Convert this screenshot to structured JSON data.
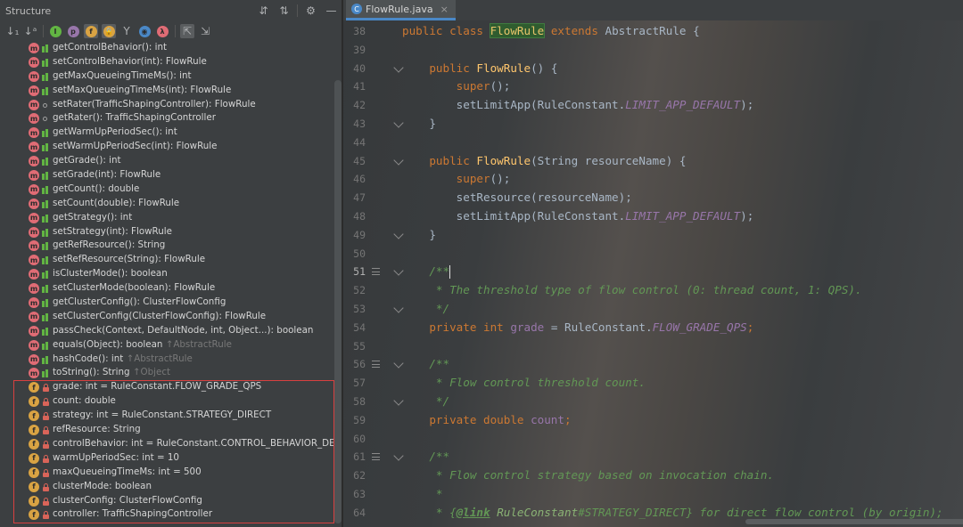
{
  "structure": {
    "title": "Structure",
    "header_icons": [
      "expand-all-icon",
      "collapse-all-icon",
      "settings-gear-icon",
      "minimize-icon"
    ],
    "toolbar_icons": [
      {
        "name": "sort-by-visibility-icon",
        "glyph": "↓₁",
        "style": "txt"
      },
      {
        "name": "sort-alphabetically-icon",
        "glyph": "↓ᵃ",
        "style": "txt"
      },
      {
        "name": "show-inherited-icon",
        "glyph": "I",
        "color": "#62b543"
      },
      {
        "name": "show-properties-icon",
        "glyph": "p",
        "color": "#9876aa"
      },
      {
        "name": "show-fields-icon",
        "glyph": "f",
        "color": "#d9a343",
        "pressed": true
      },
      {
        "name": "show-non-public-icon",
        "glyph": "🔒",
        "color": "#d9a343",
        "pressed": true
      },
      {
        "name": "show-anonymous-icon",
        "glyph": "Y",
        "style": "txt"
      },
      {
        "name": "show-lambdas-icon",
        "glyph": "◉",
        "color": "#4a88c7"
      },
      {
        "name": "show-lambda-icon",
        "glyph": "λ",
        "color": "#e06c75"
      },
      {
        "name": "autoscroll-to-source-icon",
        "glyph": "⇱",
        "style": "txt",
        "pressed": true
      },
      {
        "name": "autoscroll-from-source-icon",
        "glyph": "⇲",
        "style": "txt"
      }
    ],
    "items": [
      {
        "kind": "method",
        "vis": "public",
        "label": "getControlBehavior(): int",
        "inherited": ""
      },
      {
        "kind": "method",
        "vis": "public",
        "label": "setControlBehavior(int): FlowRule",
        "inherited": ""
      },
      {
        "kind": "method",
        "vis": "public",
        "label": "getMaxQueueingTimeMs(): int",
        "inherited": ""
      },
      {
        "kind": "method",
        "vis": "public",
        "label": "setMaxQueueingTimeMs(int): FlowRule",
        "inherited": ""
      },
      {
        "kind": "method",
        "vis": "package",
        "label": "setRater(TrafficShapingController): FlowRule",
        "inherited": ""
      },
      {
        "kind": "method",
        "vis": "package",
        "label": "getRater(): TrafficShapingController",
        "inherited": ""
      },
      {
        "kind": "method",
        "vis": "public",
        "label": "getWarmUpPeriodSec(): int",
        "inherited": ""
      },
      {
        "kind": "method",
        "vis": "public",
        "label": "setWarmUpPeriodSec(int): FlowRule",
        "inherited": ""
      },
      {
        "kind": "method",
        "vis": "public",
        "label": "getGrade(): int",
        "inherited": ""
      },
      {
        "kind": "method",
        "vis": "public",
        "label": "setGrade(int): FlowRule",
        "inherited": ""
      },
      {
        "kind": "method",
        "vis": "public",
        "label": "getCount(): double",
        "inherited": ""
      },
      {
        "kind": "method",
        "vis": "public",
        "label": "setCount(double): FlowRule",
        "inherited": ""
      },
      {
        "kind": "method",
        "vis": "public",
        "label": "getStrategy(): int",
        "inherited": ""
      },
      {
        "kind": "method",
        "vis": "public",
        "label": "setStrategy(int): FlowRule",
        "inherited": ""
      },
      {
        "kind": "method",
        "vis": "public",
        "label": "getRefResource(): String",
        "inherited": ""
      },
      {
        "kind": "method",
        "vis": "public",
        "label": "setRefResource(String): FlowRule",
        "inherited": ""
      },
      {
        "kind": "method",
        "vis": "public",
        "label": "isClusterMode(): boolean",
        "inherited": ""
      },
      {
        "kind": "method",
        "vis": "public",
        "label": "setClusterMode(boolean): FlowRule",
        "inherited": ""
      },
      {
        "kind": "method",
        "vis": "public",
        "label": "getClusterConfig(): ClusterFlowConfig",
        "inherited": ""
      },
      {
        "kind": "method",
        "vis": "public",
        "label": "setClusterConfig(ClusterFlowConfig): FlowRule",
        "inherited": ""
      },
      {
        "kind": "method",
        "vis": "public",
        "label": "passCheck(Context, DefaultNode, int, Object...): boolean",
        "inherited": ""
      },
      {
        "kind": "method",
        "vis": "public",
        "label": "equals(Object): boolean ",
        "inherited": "↑AbstractRule"
      },
      {
        "kind": "method",
        "vis": "public",
        "label": "hashCode(): int ",
        "inherited": "↑AbstractRule"
      },
      {
        "kind": "method",
        "vis": "public",
        "label": "toString(): String ",
        "inherited": "↑Object"
      },
      {
        "kind": "field",
        "vis": "private",
        "label": "grade: int = RuleConstant.FLOW_GRADE_QPS",
        "inherited": ""
      },
      {
        "kind": "field",
        "vis": "private",
        "label": "count: double",
        "inherited": ""
      },
      {
        "kind": "field",
        "vis": "private",
        "label": "strategy: int = RuleConstant.STRATEGY_DIRECT",
        "inherited": ""
      },
      {
        "kind": "field",
        "vis": "private",
        "label": "refResource: String",
        "inherited": ""
      },
      {
        "kind": "field",
        "vis": "private",
        "label": "controlBehavior: int = RuleConstant.CONTROL_BEHAVIOR_DEFAULT",
        "inherited": ""
      },
      {
        "kind": "field",
        "vis": "private",
        "label": "warmUpPeriodSec: int = 10",
        "inherited": ""
      },
      {
        "kind": "field",
        "vis": "private",
        "label": "maxQueueingTimeMs: int = 500",
        "inherited": ""
      },
      {
        "kind": "field",
        "vis": "private",
        "label": "clusterMode: boolean",
        "inherited": ""
      },
      {
        "kind": "field",
        "vis": "private",
        "label": "clusterConfig: ClusterFlowConfig",
        "inherited": ""
      },
      {
        "kind": "field",
        "vis": "private",
        "label": "controller: TrafficShapingController",
        "inherited": ""
      }
    ]
  },
  "editor": {
    "tab": {
      "label": "FlowRule.java",
      "close": "×"
    },
    "current_line": "51",
    "lines": [
      {
        "n": "38",
        "mark": "",
        "toks": [
          [
            "kw",
            "public class "
          ],
          [
            "class-hl",
            "FlowRule"
          ],
          [
            "kw",
            " extends "
          ],
          [
            "plain",
            "AbstractRule {"
          ]
        ]
      },
      {
        "n": "39",
        "mark": "",
        "toks": []
      },
      {
        "n": "40",
        "mark": "fold",
        "toks": [
          [
            "kw",
            "    public "
          ],
          [
            "ctor",
            "FlowRule"
          ],
          [
            "plain",
            "() {"
          ]
        ]
      },
      {
        "n": "41",
        "mark": "",
        "toks": [
          [
            "plain",
            "        "
          ],
          [
            "kw",
            "super"
          ],
          [
            "plain",
            "();"
          ]
        ]
      },
      {
        "n": "42",
        "mark": "",
        "toks": [
          [
            "plain",
            "        setLimitApp(RuleConstant."
          ],
          [
            "const",
            "LIMIT_APP_DEFAULT"
          ],
          [
            "plain",
            ");"
          ]
        ]
      },
      {
        "n": "43",
        "mark": "fold",
        "toks": [
          [
            "plain",
            "    }"
          ]
        ]
      },
      {
        "n": "44",
        "mark": "",
        "toks": []
      },
      {
        "n": "45",
        "mark": "fold",
        "toks": [
          [
            "kw",
            "    public "
          ],
          [
            "ctor",
            "FlowRule"
          ],
          [
            "plain",
            "(String resourceName) {"
          ]
        ]
      },
      {
        "n": "46",
        "mark": "",
        "toks": [
          [
            "plain",
            "        "
          ],
          [
            "kw",
            "super"
          ],
          [
            "plain",
            "();"
          ]
        ]
      },
      {
        "n": "47",
        "mark": "",
        "toks": [
          [
            "plain",
            "        setResource(resourceName);"
          ]
        ]
      },
      {
        "n": "48",
        "mark": "",
        "toks": [
          [
            "plain",
            "        setLimitApp(RuleConstant."
          ],
          [
            "const",
            "LIMIT_APP_DEFAULT"
          ],
          [
            "plain",
            ");"
          ]
        ]
      },
      {
        "n": "49",
        "mark": "fold",
        "toks": [
          [
            "plain",
            "    }"
          ]
        ]
      },
      {
        "n": "50",
        "mark": "",
        "toks": []
      },
      {
        "n": "51",
        "mark": "doc",
        "toks": [
          [
            "doc",
            "    /**"
          ],
          [
            "cursor",
            ""
          ]
        ]
      },
      {
        "n": "52",
        "mark": "",
        "toks": [
          [
            "doc",
            "     * The threshold type of flow control (0: thread count, 1: QPS)."
          ]
        ]
      },
      {
        "n": "53",
        "mark": "fold",
        "toks": [
          [
            "doc",
            "     */"
          ]
        ]
      },
      {
        "n": "54",
        "mark": "",
        "toks": [
          [
            "kw",
            "    private int "
          ],
          [
            "field",
            "grade"
          ],
          [
            "plain",
            " = RuleConstant."
          ],
          [
            "const",
            "FLOW_GRADE_QPS"
          ],
          [
            "kw",
            ";"
          ]
        ]
      },
      {
        "n": "55",
        "mark": "",
        "toks": []
      },
      {
        "n": "56",
        "mark": "doc",
        "toks": [
          [
            "doc",
            "    /**"
          ]
        ]
      },
      {
        "n": "57",
        "mark": "",
        "toks": [
          [
            "doc",
            "     * Flow control threshold count."
          ]
        ]
      },
      {
        "n": "58",
        "mark": "fold",
        "toks": [
          [
            "doc",
            "     */"
          ]
        ]
      },
      {
        "n": "59",
        "mark": "",
        "toks": [
          [
            "kw",
            "    private double "
          ],
          [
            "field",
            "count"
          ],
          [
            "kw",
            ";"
          ]
        ]
      },
      {
        "n": "60",
        "mark": "",
        "toks": []
      },
      {
        "n": "61",
        "mark": "doc",
        "toks": [
          [
            "doc",
            "    /**"
          ]
        ]
      },
      {
        "n": "62",
        "mark": "",
        "toks": [
          [
            "doc",
            "     * Flow control strategy based on invocation chain."
          ]
        ]
      },
      {
        "n": "63",
        "mark": "",
        "toks": [
          [
            "doc",
            "     *"
          ]
        ]
      },
      {
        "n": "64",
        "mark": "",
        "toks": [
          [
            "doc",
            "     * {"
          ],
          [
            "doctag",
            "@link"
          ],
          [
            "doc",
            " "
          ],
          [
            "docref",
            "RuleConstant"
          ],
          [
            "doc",
            "#STRATEGY_DIRECT} for direct flow control (by origin);"
          ]
        ]
      }
    ]
  },
  "colors": {
    "accent": "#4a88c7",
    "highlight_box": "#d84040",
    "method_icon": "#e06c75",
    "field_icon": "#d9a343"
  }
}
